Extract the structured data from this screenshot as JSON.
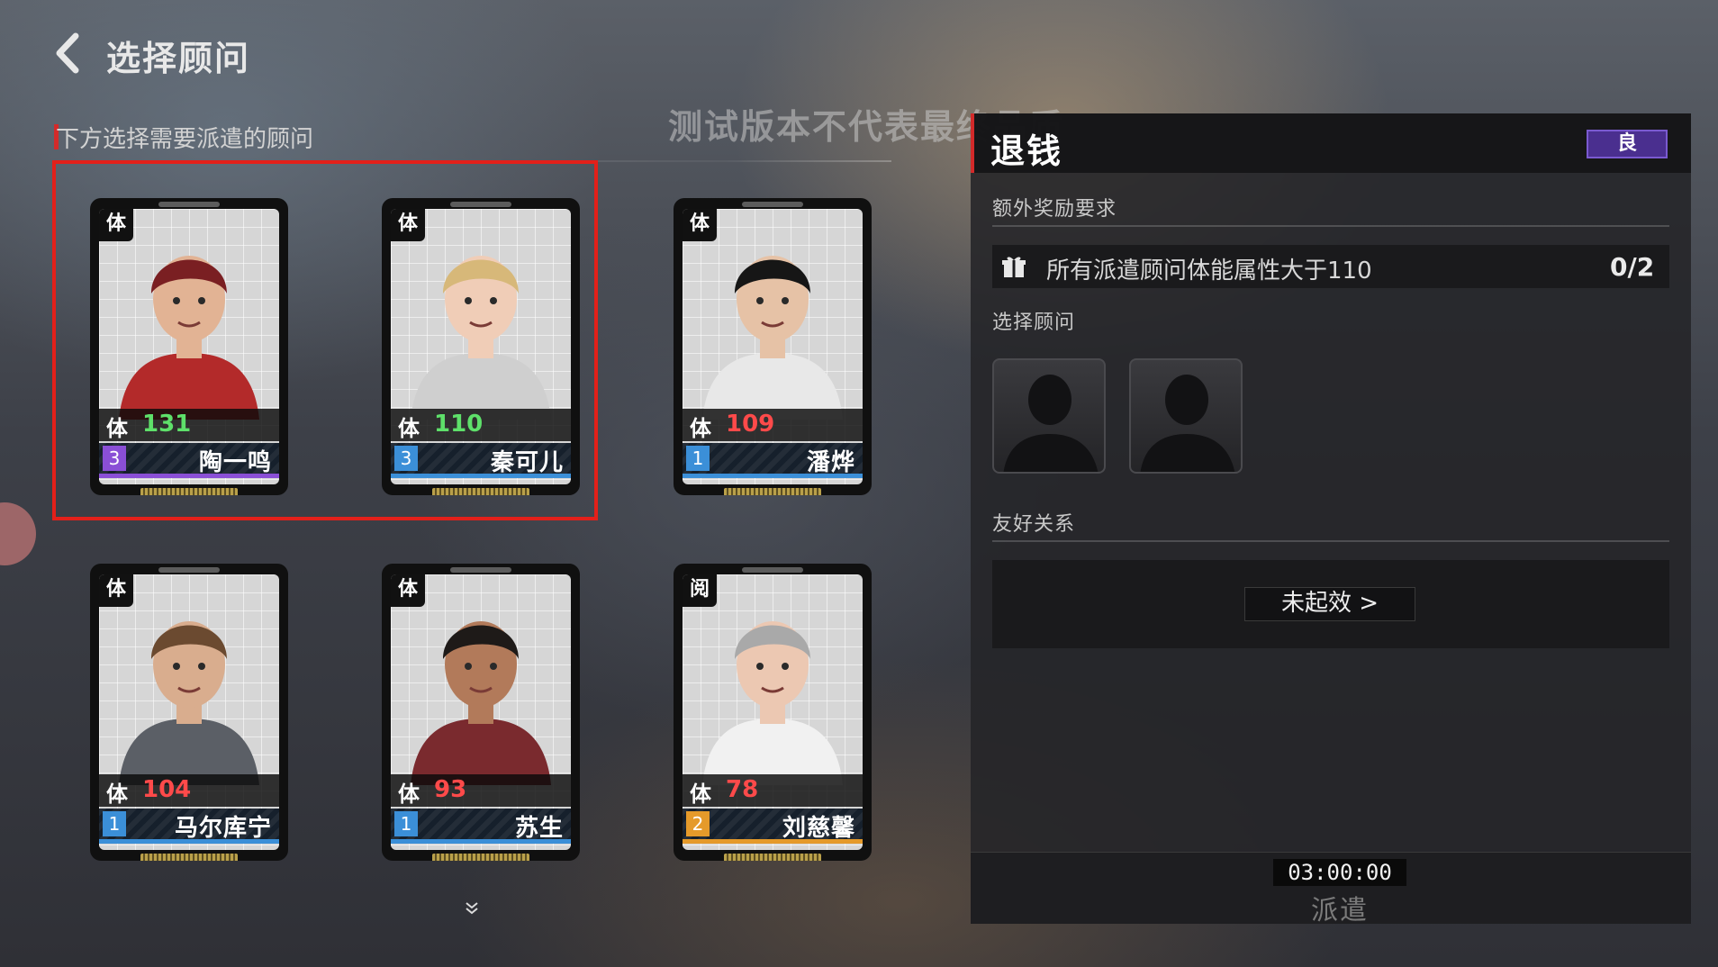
{
  "header": {
    "title": "选择顾问"
  },
  "left": {
    "section_label": "下方选择需要派遣的顾问",
    "watermark": "测试版本不代表最终品质"
  },
  "cards": [
    {
      "type": "体",
      "stat_label": "体",
      "stat_value": "131",
      "stat_color": "#5ee06a",
      "level": "3",
      "name": "陶一鸣",
      "rarity_color": "#8a4fd6",
      "selected": true
    },
    {
      "type": "体",
      "stat_label": "体",
      "stat_value": "110",
      "stat_color": "#5ee06a",
      "level": "3",
      "name": "秦可儿",
      "rarity_color": "#3b8fd8",
      "selected": true
    },
    {
      "type": "体",
      "stat_label": "体",
      "stat_value": "109",
      "stat_color": "#ff4a4a",
      "level": "1",
      "name": "潘烨",
      "rarity_color": "#3b8fd8",
      "selected": false
    },
    {
      "type": "体",
      "stat_label": "体",
      "stat_value": "104",
      "stat_color": "#ff4a4a",
      "level": "1",
      "name": "马尔库宁",
      "rarity_color": "#3b8fd8",
      "selected": false
    },
    {
      "type": "体",
      "stat_label": "体",
      "stat_value": "93",
      "stat_color": "#ff4a4a",
      "level": "1",
      "name": "苏生",
      "rarity_color": "#3b8fd8",
      "selected": false
    },
    {
      "type": "阅",
      "stat_label": "体",
      "stat_value": "78",
      "stat_color": "#ff4a4a",
      "level": "2",
      "name": "刘慈馨",
      "rarity_color": "#e59a2a",
      "selected": false
    }
  ],
  "mission": {
    "title": "退钱",
    "quality": "良",
    "extra_reward_label": "额外奖励要求",
    "reward_text": "所有派遣顾问体能属性大于110",
    "reward_progress": "0/2",
    "select_label": "选择顾问",
    "friend_label": "友好关系",
    "friend_status": "未起效 >",
    "timer": "03:00:00",
    "dispatch": "派遣"
  },
  "icons": [
    "back-arrow-icon",
    "gift-icon",
    "scroll-down-icon",
    "silhouette-icon"
  ]
}
